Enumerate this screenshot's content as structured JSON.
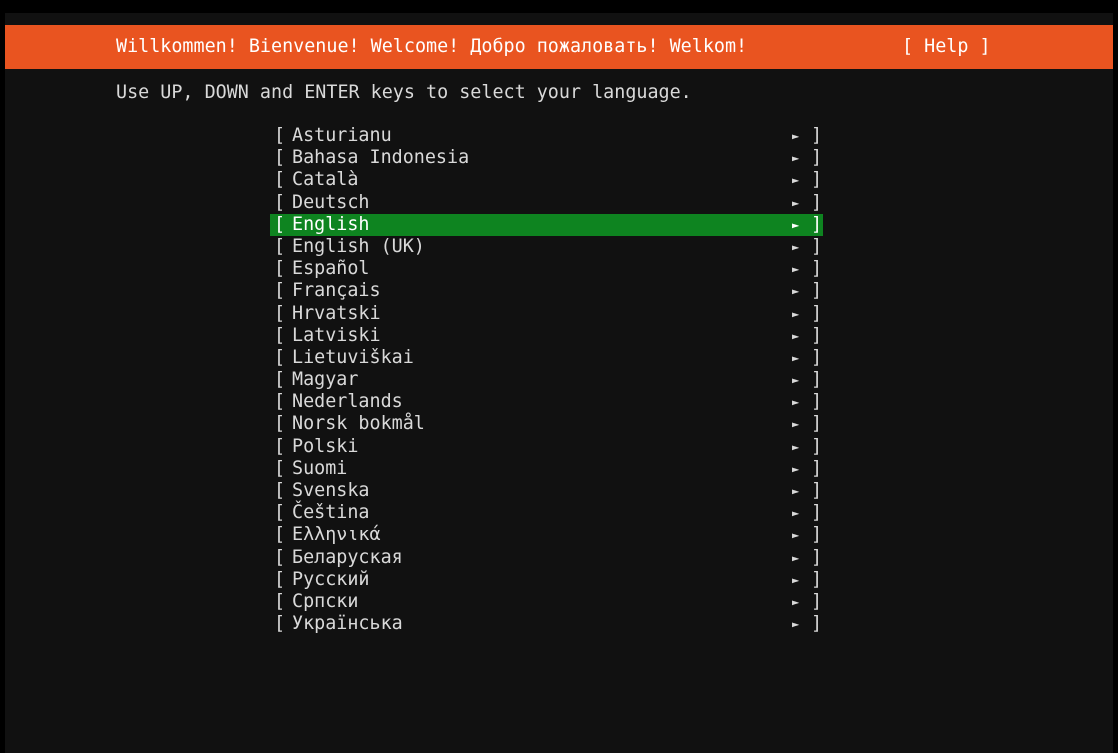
{
  "header": {
    "title": "Willkommen! Bienvenue! Welcome! Добро пожаловать! Welkom!",
    "help_label": "[ Help ]"
  },
  "instructions": "Use UP, DOWN and ENTER keys to select your language.",
  "languages": [
    {
      "label": "Asturianu"
    },
    {
      "label": "Bahasa Indonesia"
    },
    {
      "label": "Català"
    },
    {
      "label": "Deutsch"
    },
    {
      "label": "English",
      "selected": true
    },
    {
      "label": "English (UK)"
    },
    {
      "label": "Español"
    },
    {
      "label": "Français"
    },
    {
      "label": "Hrvatski"
    },
    {
      "label": "Latviski"
    },
    {
      "label": "Lietuviškai"
    },
    {
      "label": "Magyar"
    },
    {
      "label": "Nederlands"
    },
    {
      "label": "Norsk bokmål"
    },
    {
      "label": "Polski"
    },
    {
      "label": "Suomi"
    },
    {
      "label": "Svenska"
    },
    {
      "label": "Čeština"
    },
    {
      "label": "Ελληνικά"
    },
    {
      "label": "Беларуская"
    },
    {
      "label": "Русский"
    },
    {
      "label": "Српски"
    },
    {
      "label": "Українська"
    }
  ],
  "glyphs": {
    "open_bracket": "[",
    "close_bracket": "]",
    "arrow": "►"
  },
  "icons": {
    "arrow": "submenu-arrow-icon"
  },
  "colors": {
    "background": "#111111",
    "header_bg": "#e95420",
    "selected_bg": "#0e8420",
    "text": "#d9d9d9"
  }
}
